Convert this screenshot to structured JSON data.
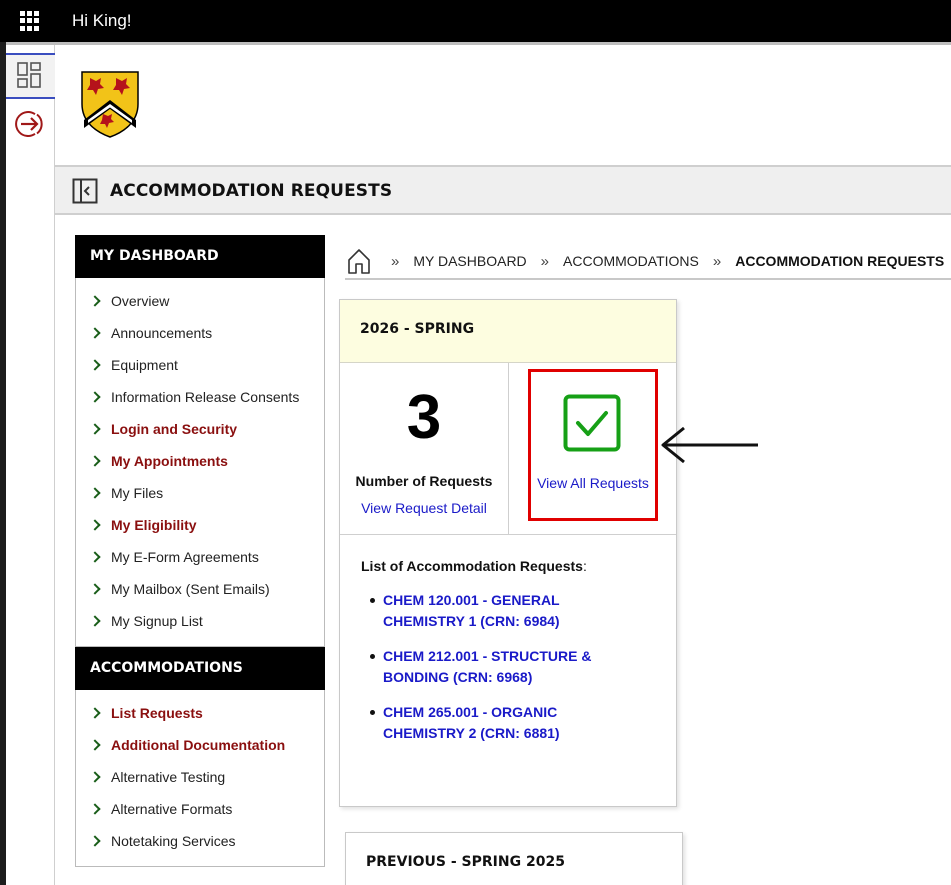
{
  "header": {
    "greeting": "Hi King!",
    "apps_icon": "grid-icon"
  },
  "rail": {
    "dashboard_icon": "dashboard-icon",
    "logout_icon": "logout-icon",
    "accent": "#3a4dbf"
  },
  "page": {
    "title": "ACCOMMODATION REQUESTS"
  },
  "sidebar": {
    "dashboard_heading": "MY DASHBOARD",
    "dashboard_items": [
      {
        "label": "Overview",
        "bold": false
      },
      {
        "label": "Announcements",
        "bold": false
      },
      {
        "label": "Equipment",
        "bold": false
      },
      {
        "label": "Information Release Consents",
        "bold": false
      },
      {
        "label": "Login and Security",
        "bold": true
      },
      {
        "label": "My Appointments",
        "bold": true
      },
      {
        "label": "My Files",
        "bold": false
      },
      {
        "label": "My Eligibility",
        "bold": true
      },
      {
        "label": "My E-Form Agreements",
        "bold": false
      },
      {
        "label": "My Mailbox (Sent Emails)",
        "bold": false
      },
      {
        "label": "My Signup List",
        "bold": false
      }
    ],
    "accommodations_heading": "ACCOMMODATIONS",
    "accommodations_items": [
      {
        "label": "List Requests",
        "bold": true
      },
      {
        "label": "Additional Documentation",
        "bold": true
      },
      {
        "label": "Alternative Testing",
        "bold": false
      },
      {
        "label": "Alternative Formats",
        "bold": false
      },
      {
        "label": "Notetaking Services",
        "bold": false
      }
    ]
  },
  "breadcrumb": {
    "sep": "»",
    "items": [
      "MY DASHBOARD",
      "ACCOMMODATIONS",
      "ACCOMMODATION REQUESTS"
    ]
  },
  "current_term": {
    "heading": "2026 - SPRING",
    "request_count": "3",
    "count_label": "Number of Requests",
    "detail_link": "View Request Detail",
    "view_all_link": "View All Requests",
    "list_title": "List of Accommodation Requests",
    "list_colon": ":",
    "requests": [
      "CHEM 120.001 - GENERAL CHEMISTRY 1 (CRN: 6984)",
      "CHEM 212.001 - STRUCTURE & BONDING (CRN: 6968)",
      "CHEM 265.001 - ORGANIC CHEMISTRY 2 (CRN: 6881)"
    ],
    "check_color": "#16a016",
    "highlight_color": "#e00000"
  },
  "previous_term": {
    "heading": "PREVIOUS - SPRING 2025"
  },
  "colors": {
    "link": "#1a1ac8",
    "bold_link": "#8a0f0f",
    "chevron": "#1a5e1a",
    "term_header_bg": "#fdfde0"
  }
}
